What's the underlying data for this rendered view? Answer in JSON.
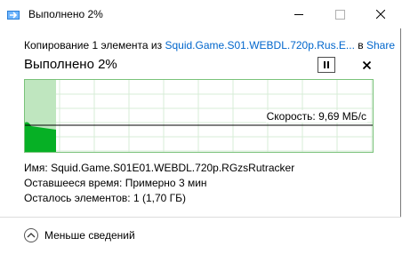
{
  "window": {
    "title": "Выполнено 2%",
    "minimize_glyph": "—",
    "close_glyph": "✕"
  },
  "copy": {
    "prefix": "Копирование 1 элемента из ",
    "source": "Squid.Game.S01.WEBDL.720p.Rus.E...",
    "middle": " в ",
    "destination": "Share"
  },
  "progress": {
    "title": "Выполнено 2%",
    "percent": 2,
    "pause_icon": "pause-icon",
    "cancel_glyph": "✕"
  },
  "graph": {
    "speed_label": "Скорость: 9,69 МБ/с",
    "progress_fraction": 0.02,
    "colors": {
      "grid": "#d7ecd7",
      "fill_light": "#bfe6bf",
      "fill_dark": "#06b025",
      "border": "#7ac27a",
      "speed_line": "#000000"
    }
  },
  "details": {
    "name_label": "Имя:",
    "name_value": "Squid.Game.S01E01.WEBDL.720p.RGzsRutracker",
    "time_label": "Оставшееся время:",
    "time_value": "Примерно 3 мин",
    "items_label": "Осталось элементов:",
    "items_value": "1 (1,70 ГБ)"
  },
  "footer": {
    "less_details": "Меньше сведений"
  }
}
